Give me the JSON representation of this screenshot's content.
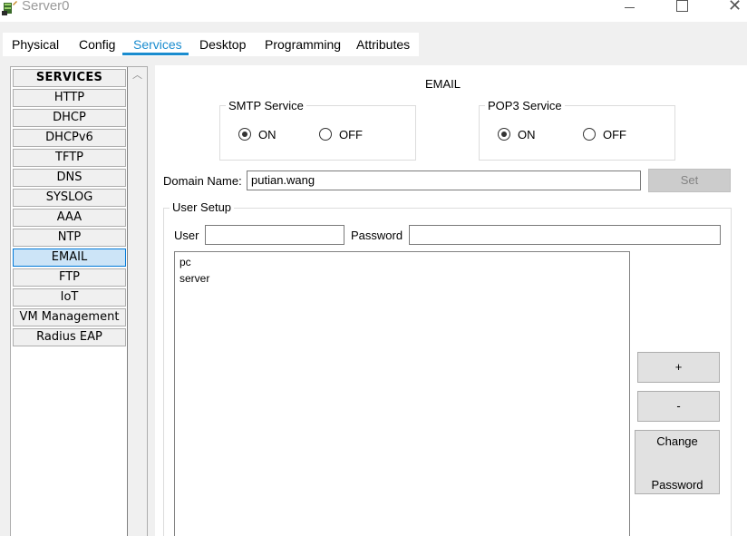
{
  "window": {
    "title": "Server0",
    "minimize": "—",
    "close": "✕"
  },
  "tabs": [
    {
      "label": "Physical"
    },
    {
      "label": "Config"
    },
    {
      "label": "Services"
    },
    {
      "label": "Desktop"
    },
    {
      "label": "Programming"
    },
    {
      "label": "Attributes"
    }
  ],
  "active_tab": "Services",
  "sidebar": {
    "header": "SERVICES",
    "items": [
      "HTTP",
      "DHCP",
      "DHCPv6",
      "TFTP",
      "DNS",
      "SYSLOG",
      "AAA",
      "NTP",
      "EMAIL",
      "FTP",
      "IoT",
      "VM Management",
      "Radius EAP"
    ],
    "selected": "EMAIL"
  },
  "panel": {
    "title": "EMAIL"
  },
  "smtp": {
    "legend": "SMTP Service",
    "on_label": "ON",
    "off_label": "OFF",
    "value": "ON"
  },
  "pop3": {
    "legend": "POP3 Service",
    "on_label": "ON",
    "off_label": "OFF",
    "value": "ON"
  },
  "domain": {
    "label": "Domain Name:",
    "value": "putian.wang",
    "set_label": "Set"
  },
  "user_setup": {
    "legend": "User Setup",
    "user_label": "User",
    "user_value": "",
    "password_label": "Password",
    "password_value": "",
    "users": [
      "pc",
      "server"
    ],
    "add_label": "+",
    "remove_label": "-",
    "change_label_line1": "Change",
    "change_label_line2": "Password"
  },
  "colors": {
    "accent": "#1a8ccf",
    "selected_bg": "#cce4f7",
    "selected_border": "#0078d7"
  }
}
